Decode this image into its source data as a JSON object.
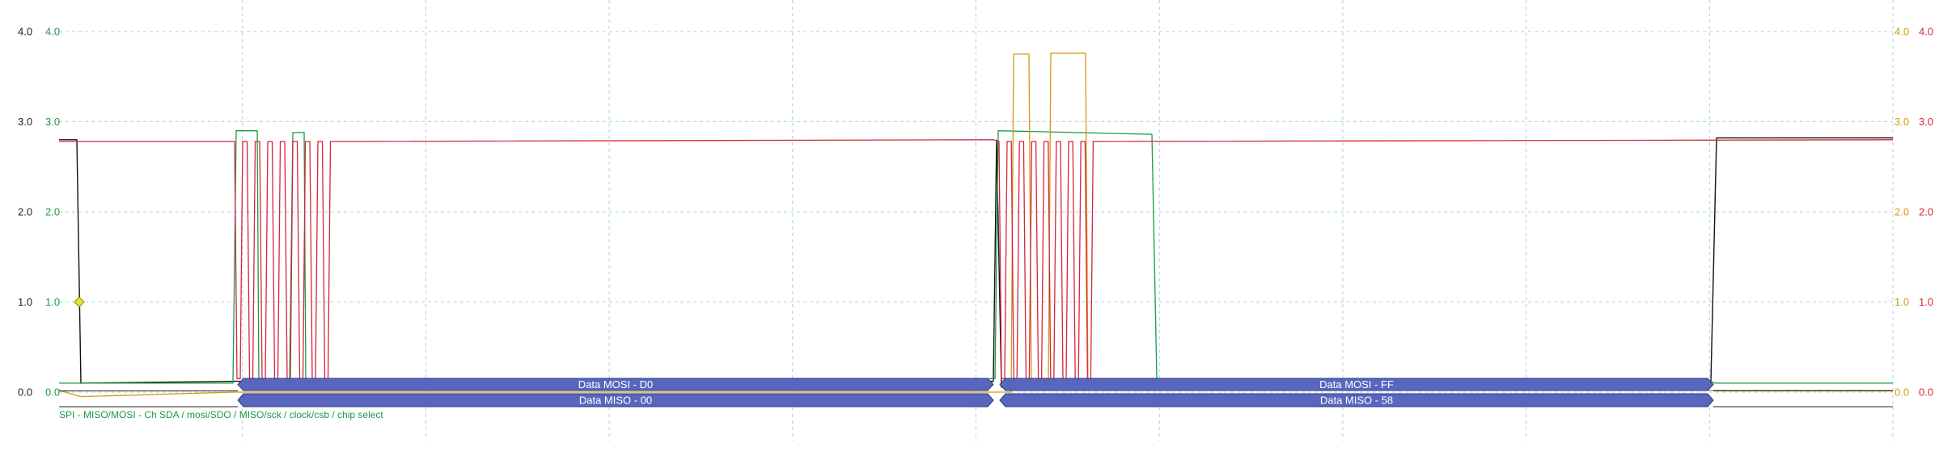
{
  "colors": {
    "background": "#ffffff",
    "grid": "#a9d3e8",
    "axis_black": "#222222",
    "axis_green": "#1a9a45",
    "axis_orange": "#d39a12",
    "axis_red": "#d8243a",
    "trace_chip_select": "#111111",
    "trace_clock": "#d8243a",
    "trace_mosi": "#d39a12",
    "trace_miso": "#1a9a45",
    "packet_fill": "#5866bd",
    "packet_stroke": "#2e3a86",
    "marker": "#e6e62a"
  },
  "axes": {
    "left_black": [
      "4.0",
      "3.0",
      "2.0",
      "1.0",
      "0.0"
    ],
    "left_green": [
      "4.0",
      "3.0",
      "2.0",
      "1.0",
      "0.0"
    ],
    "right_orange": [
      "4.0",
      "3.0",
      "2.0",
      "1.0",
      "0.0"
    ],
    "right_red": [
      "4.0",
      "3.0",
      "2.0",
      "1.0",
      "0.0"
    ]
  },
  "packets": {
    "mosi": [
      {
        "label": "Data MOSI - D0"
      },
      {
        "label": "Data MOSI - FF"
      }
    ],
    "miso": [
      {
        "label": "Data MISO - 00"
      },
      {
        "label": "Data MISO - 58"
      }
    ]
  },
  "decoder_label": "SPI - MISO/MOSI - Ch SDA / mosi/SDO / MISO/sck / clock/csb / chip select",
  "icons": {
    "trigger_marker": "diamond-marker-icon"
  }
}
